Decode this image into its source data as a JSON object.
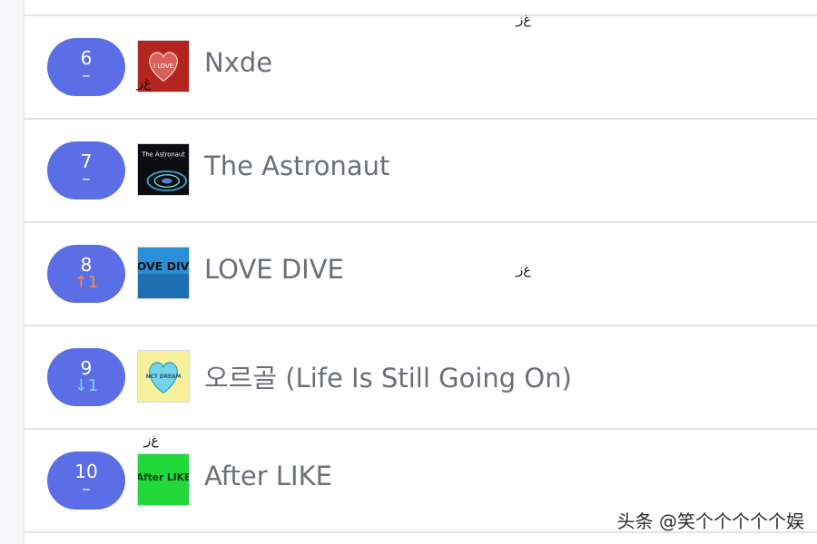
{
  "chart_list": {
    "rows": [
      {
        "rank": "6",
        "change": "–",
        "change_type": "same",
        "title": "Nxde",
        "cover_icon": "nxde-album-cover"
      },
      {
        "rank": "7",
        "change": "–",
        "change_type": "same",
        "title": "The Astronaut",
        "cover_icon": "the-astronaut-album-cover"
      },
      {
        "rank": "8",
        "change": "↑1",
        "change_type": "up",
        "title": "LOVE DIVE",
        "cover_icon": "love-dive-album-cover"
      },
      {
        "rank": "9",
        "change": "↓1",
        "change_type": "down",
        "title": "오르골 (Life Is Still Going On)",
        "cover_icon": "nct-dream-album-cover"
      },
      {
        "rank": "10",
        "change": "–",
        "change_type": "same",
        "title": "After LIKE",
        "cover_icon": "after-like-album-cover"
      }
    ]
  },
  "cover_text": {
    "nxde": "I LOVE",
    "astronaut": "The Astronaut",
    "love_dive": "LOVE DIVE",
    "nct": "NCT DREAM",
    "after_like": "After LIKE"
  },
  "watermark": "头条 @笑个个个个个娱",
  "colors": {
    "pill": "#5b6ee6",
    "up": "#ff8a3d",
    "down": "#7ad3ff",
    "title": "#6b6f76"
  }
}
